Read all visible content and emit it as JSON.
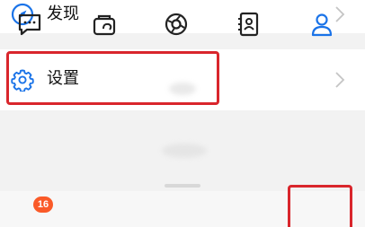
{
  "menu": {
    "discover_label": "发现",
    "settings_label": "设置"
  },
  "tabbar": {
    "chat_badge": "16",
    "tabs": [
      {
        "icon": "chat-icon"
      },
      {
        "icon": "wallet-icon"
      },
      {
        "icon": "moments-icon"
      },
      {
        "icon": "contacts-icon"
      },
      {
        "icon": "profile-icon"
      }
    ]
  },
  "colors": {
    "accent": "#1a73e8",
    "highlight": "#d9262c",
    "badge": "#fa5a28"
  }
}
